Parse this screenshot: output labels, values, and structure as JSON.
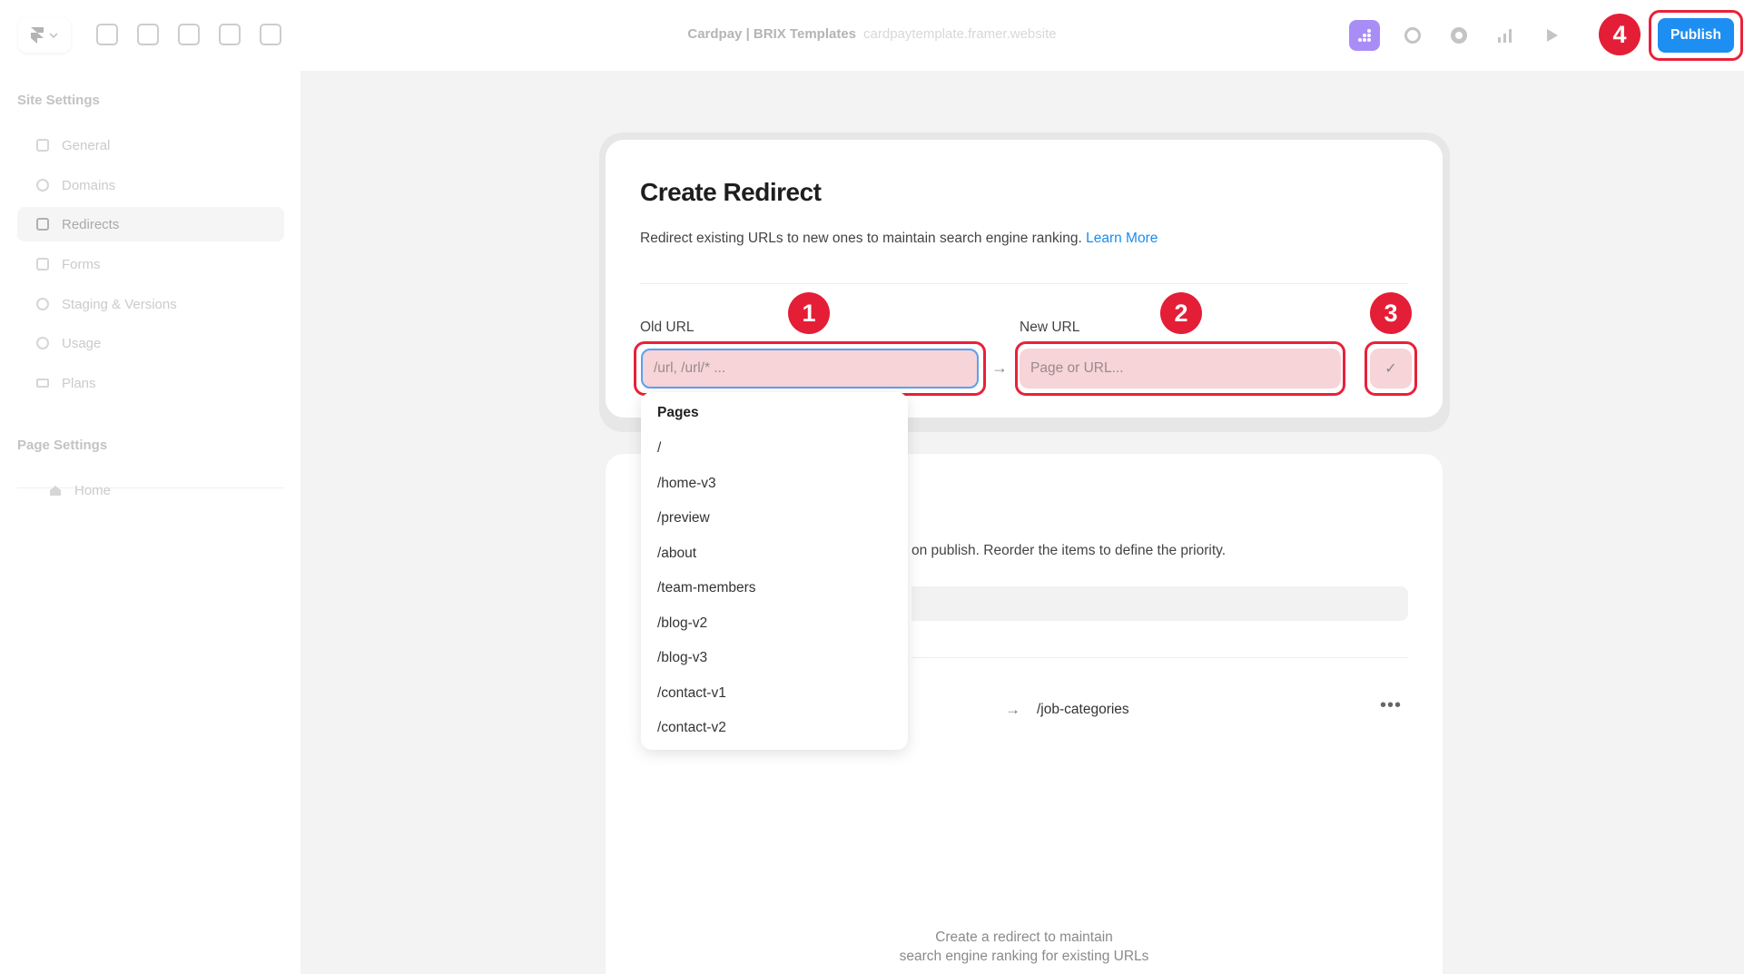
{
  "topbar": {
    "site_name": "Cardpay | BRIX Templates",
    "site_url": "cardpaytemplate.framer.website",
    "publish_label": "Publish",
    "left_icons": [
      "framer-logo-icon",
      "insert-icon",
      "layout-icon",
      "text-icon",
      "vector-icon",
      "cms-icon"
    ],
    "right_icons": [
      "site-settings-icon",
      "globe-icon",
      "settings-icon",
      "analytics-icon",
      "play-icon"
    ]
  },
  "sidebar": {
    "site_settings_heading": "Site Settings",
    "items": [
      {
        "label": "General",
        "icon": "general-icon"
      },
      {
        "label": "Domains",
        "icon": "domains-icon"
      },
      {
        "label": "Redirects",
        "icon": "redirects-icon"
      },
      {
        "label": "Forms",
        "icon": "forms-icon"
      },
      {
        "label": "Staging & Versions",
        "icon": "staging-icon"
      },
      {
        "label": "Usage",
        "icon": "usage-icon"
      },
      {
        "label": "Plans",
        "icon": "plans-icon"
      }
    ],
    "active_item": "Redirects",
    "page_settings_heading": "Page Settings",
    "pages": [
      {
        "label": "Home",
        "icon": "home-icon"
      }
    ]
  },
  "create_redirect": {
    "title": "Create Redirect",
    "description": "Redirect existing URLs to new ones to maintain search engine ranking.",
    "learn_more": "Learn More",
    "old_url_label": "Old URL",
    "old_url_placeholder": "/url, /url/* ...",
    "new_url_label": "New URL",
    "new_url_placeholder": "Page or URL...",
    "confirm_icon": "check-icon"
  },
  "dropdown": {
    "heading": "Pages",
    "options": [
      "/",
      "/home-v3",
      "/preview",
      "/about",
      "/team-members",
      "/blog-v2",
      "/blog-v3",
      "/contact-v1",
      "/contact-v2"
    ]
  },
  "redirects_list": {
    "description_fragment": "on publish. Reorder the items to define the priority.",
    "row_target": "/job-categories",
    "row_menu": "•••",
    "empty_line1": "Create a redirect to maintain",
    "empty_line2": "search engine ranking for existing URLs"
  },
  "annotations": {
    "badges": [
      "1",
      "2",
      "3",
      "4"
    ],
    "highlight_color": "#e8213a"
  },
  "colors": {
    "accent": "#1d8ef2",
    "link": "#1a8cf0",
    "highlight_fill": "#f6d4d7"
  }
}
